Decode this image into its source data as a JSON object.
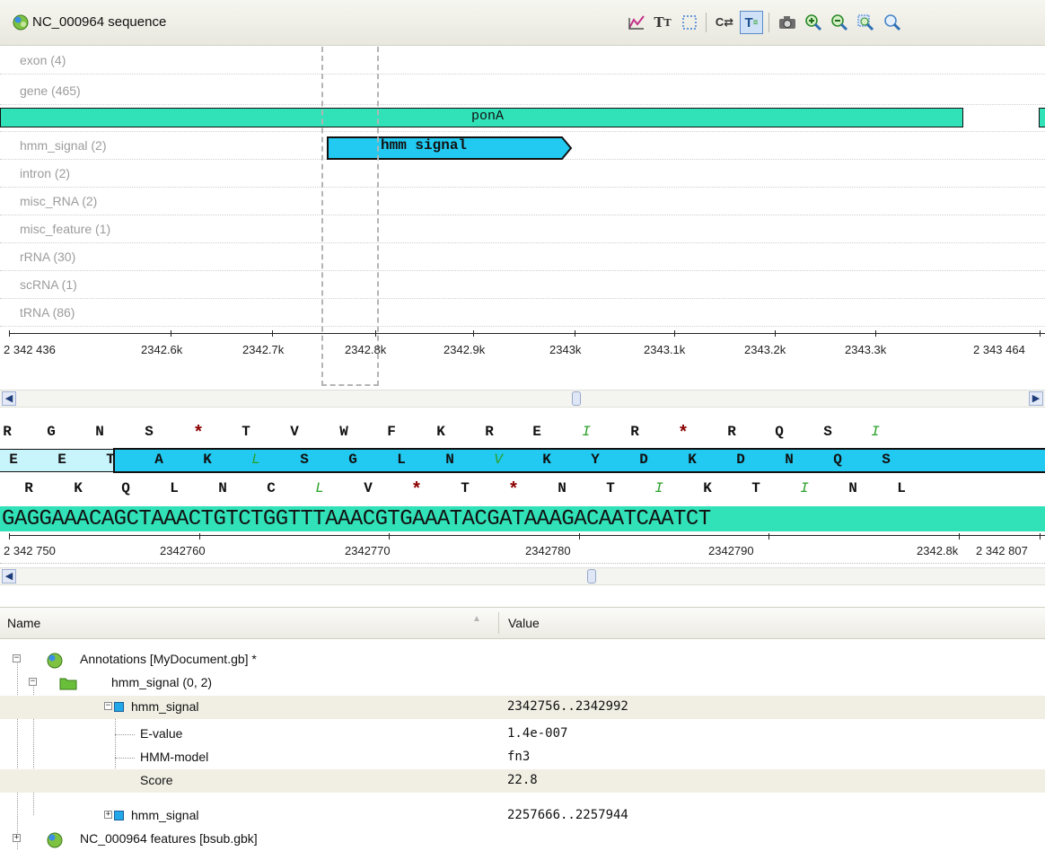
{
  "window": {
    "title": "NC_000964 sequence"
  },
  "toolbar": {
    "icons": [
      "graph-icon",
      "text-format-icon",
      "selection-icon",
      "compare-icon",
      "translation-icon",
      "camera-icon",
      "zoom-in-icon",
      "zoom-out-icon",
      "zoom-fit-icon",
      "zoom-search-icon"
    ],
    "active": [
      "translation-icon"
    ],
    "glyphs": {
      "text_format": "T",
      "compare": "C⇄",
      "translation": "T"
    }
  },
  "feature_rows": [
    {
      "label": "exon (4)"
    },
    {
      "label": "gene (465)"
    },
    {
      "label": ""
    },
    {
      "label": "hmm_signal (2)"
    },
    {
      "label": "intron (2)"
    },
    {
      "label": "misc_RNA (2)"
    },
    {
      "label": "misc_feature (1)"
    },
    {
      "label": "rRNA (30)"
    },
    {
      "label": "scRNA (1)"
    },
    {
      "label": "tRNA (86)"
    }
  ],
  "annotations": {
    "gene_label": "ponA",
    "hmm_label": "hmm signal"
  },
  "overview_ruler": {
    "labels": [
      "2 342 436",
      "2342.6k",
      "2342.7k",
      "2342.8k",
      "2342.9k",
      "2343k",
      "2343.1k",
      "2343.2k",
      "2343.3k",
      "2 343 464"
    ]
  },
  "translation": {
    "frame1": [
      "R",
      "G",
      "N",
      "S",
      "*",
      "T",
      "V",
      "W",
      "F",
      "K",
      "R",
      "E",
      "I",
      "R",
      "*",
      "R",
      "Q",
      "S",
      "I"
    ],
    "frame2": [
      "E",
      "E",
      "T",
      "A",
      "K",
      "L",
      "S",
      "G",
      "L",
      "N",
      "V",
      "K",
      "Y",
      "D",
      "K",
      "D",
      "N",
      "Q",
      "S"
    ],
    "frame3": [
      "R",
      "K",
      "Q",
      "L",
      "N",
      "C",
      "L",
      "V",
      "*",
      "T",
      "*",
      "N",
      "T",
      "I",
      "K",
      "T",
      "I",
      "N",
      "L"
    ]
  },
  "sequence": "GAGGAAACAGCTAAACTGTCTGGTTTAAACGTGAAATACGATAAAGACAATCAATCT",
  "detail_ruler": {
    "labels": [
      "2 342 750",
      "2342760",
      "2342770",
      "2342780",
      "2342790",
      "2342.8k",
      "2 342 807"
    ]
  },
  "tree": {
    "columns": {
      "name": "Name",
      "value": "Value"
    },
    "rows": [
      {
        "name": "Annotations [MyDocument.gb] *",
        "value": ""
      },
      {
        "name": "hmm_signal  (0, 2)",
        "value": ""
      },
      {
        "name": "hmm_signal",
        "value": "2342756..2342992"
      },
      {
        "name": "E-value",
        "value": "1.4e-007"
      },
      {
        "name": "HMM-model",
        "value": "fn3"
      },
      {
        "name": "Score",
        "value": "22.8"
      },
      {
        "name": "hmm_signal",
        "value": "2257666..2257944"
      },
      {
        "name": "NC_000964 features [bsub.gbk]",
        "value": ""
      }
    ]
  },
  "colors": {
    "gene": "#31e2b9",
    "hmm": "#22c9f0",
    "stop": "#8b0000",
    "hydrophobic": "#2aa12a"
  }
}
